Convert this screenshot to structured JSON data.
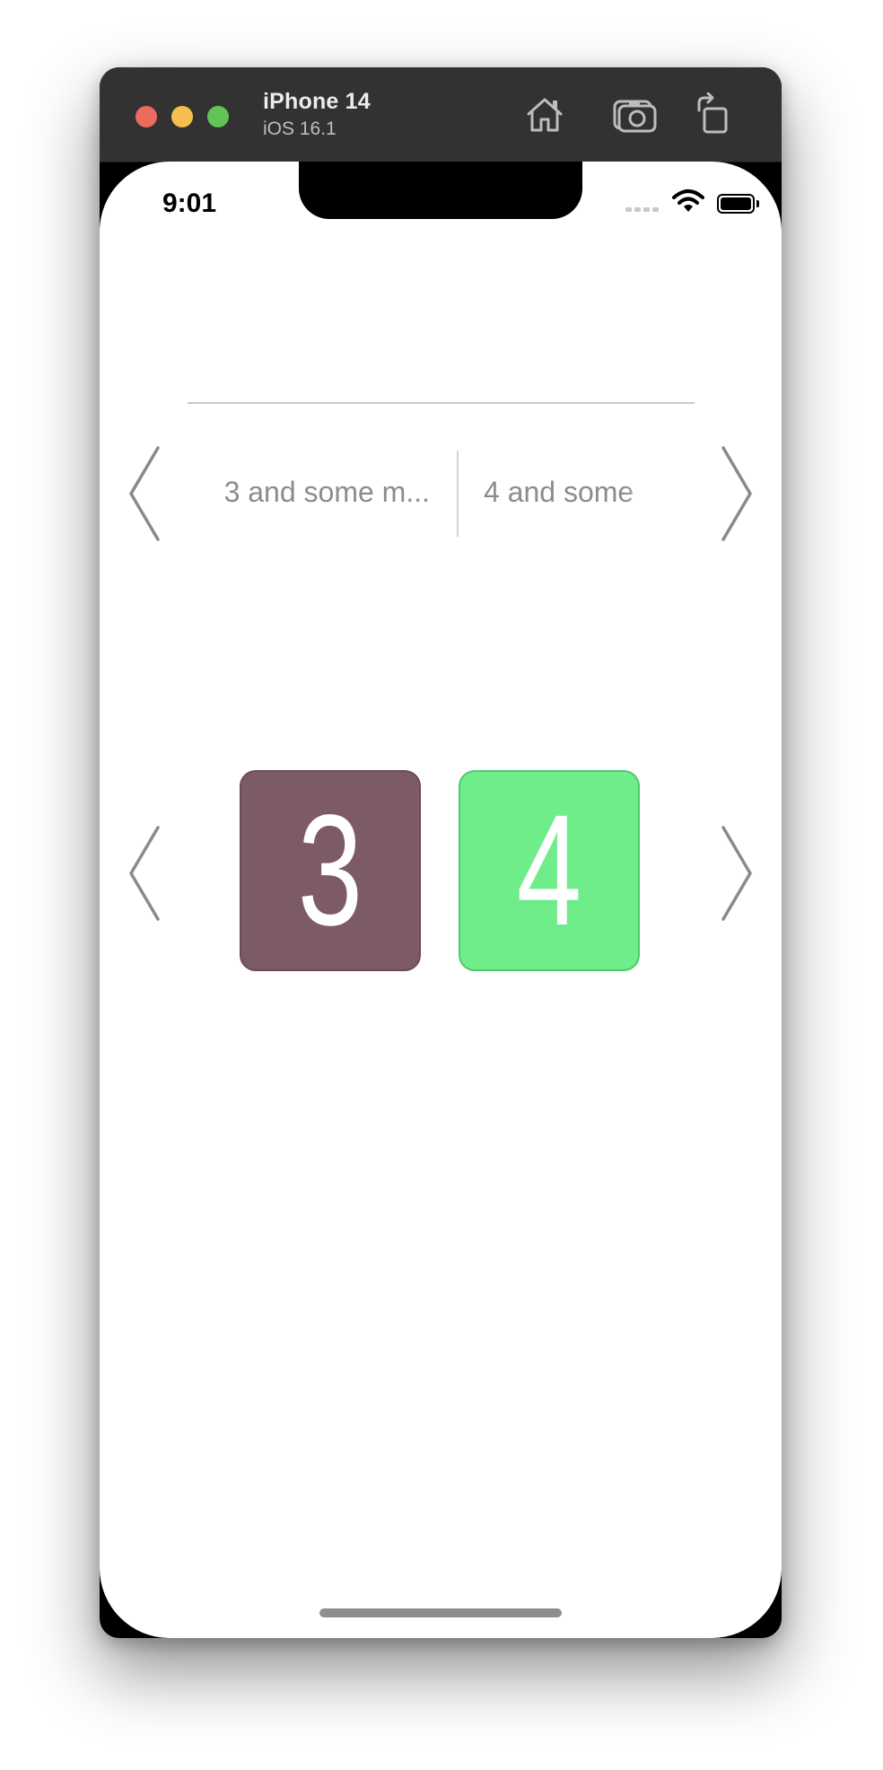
{
  "simulator": {
    "device_name": "iPhone 14",
    "os_version": "iOS 16.1",
    "toolbar": {
      "home_icon": "home-icon",
      "screenshot_icon": "camera-icon",
      "rotate_icon": "rotate-icon"
    },
    "traffic_lights": {
      "close_color": "#ed6a5e",
      "minimize_color": "#f4bf4f",
      "zoom_color": "#61c454"
    }
  },
  "status_bar": {
    "time": "9:01",
    "icons": [
      "cellular-signal-icon",
      "wifi-icon",
      "battery-icon"
    ]
  },
  "text_carousel": {
    "items": [
      "3 and some m...",
      "4 and some"
    ],
    "prev_icon": "chevron-left-icon",
    "next_icon": "chevron-right-icon"
  },
  "tile_carousel": {
    "tiles": [
      {
        "label": "3",
        "color": "#7c5b66"
      },
      {
        "label": "4",
        "color": "#6eed8a"
      }
    ],
    "prev_icon": "chevron-left-icon",
    "next_icon": "chevron-right-icon"
  }
}
